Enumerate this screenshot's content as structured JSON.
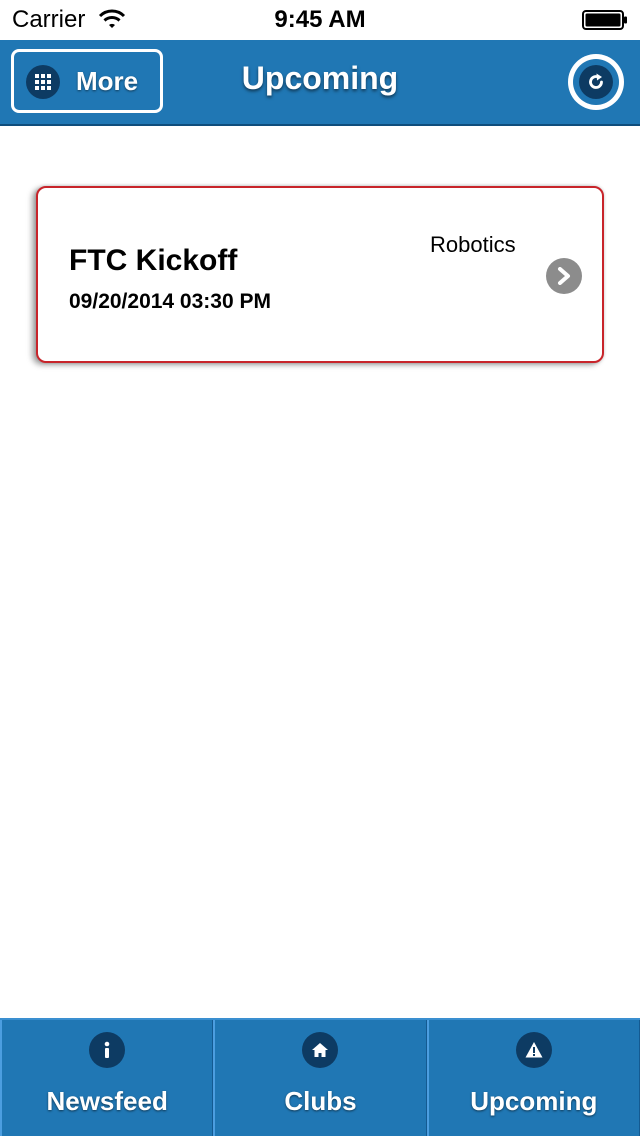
{
  "status_bar": {
    "carrier": "Carrier",
    "time": "9:45 AM"
  },
  "header": {
    "more_label": "More",
    "title": "Upcoming",
    "icons": {
      "more": "grid-icon",
      "refresh": "refresh-icon"
    }
  },
  "events": [
    {
      "title": "FTC Kickoff",
      "datetime": "09/20/2014 03:30 PM",
      "club": "Robotics"
    }
  ],
  "tabs": [
    {
      "label": "Newsfeed",
      "icon": "info-icon"
    },
    {
      "label": "Clubs",
      "icon": "home-icon"
    },
    {
      "label": "Upcoming",
      "icon": "warning-icon"
    }
  ],
  "colors": {
    "brand_blue": "#2077b4",
    "icon_dark": "#0d3b63",
    "card_border": "#c8242a",
    "chevron_gray": "#8c8c8c"
  }
}
